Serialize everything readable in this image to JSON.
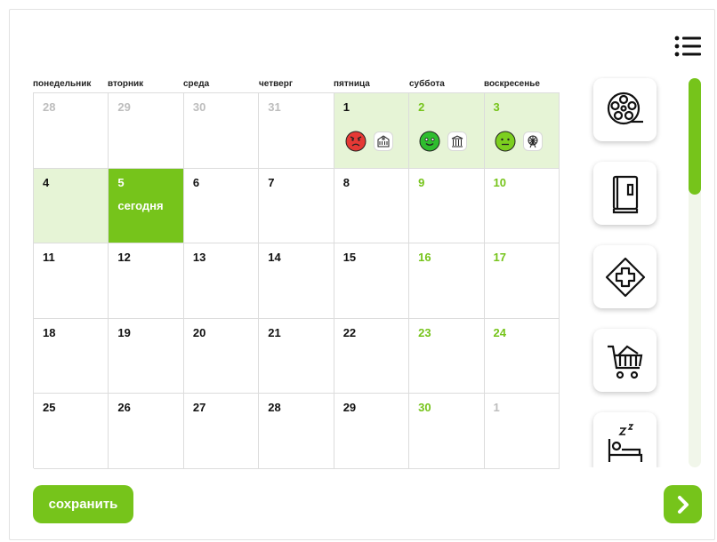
{
  "calendar": {
    "weekdays": [
      "понедельник",
      "вторник",
      "среда",
      "четверг",
      "пятница",
      "суббота",
      "воскресенье"
    ],
    "today_label": "сегодня",
    "weeks": [
      [
        {
          "day": "28",
          "muted": true
        },
        {
          "day": "29",
          "muted": true
        },
        {
          "day": "30",
          "muted": true
        },
        {
          "day": "31",
          "muted": true
        },
        {
          "day": "1",
          "event": {
            "mood": "angry",
            "place": "building"
          }
        },
        {
          "day": "2",
          "weekend": true,
          "event": {
            "mood": "happy",
            "place": "building-columns"
          }
        },
        {
          "day": "3",
          "weekend": true,
          "event": {
            "mood": "neutral",
            "place": "ferris-wheel"
          }
        }
      ],
      [
        {
          "day": "4",
          "highlight": true
        },
        {
          "day": "5",
          "today": true
        },
        {
          "day": "6"
        },
        {
          "day": "7"
        },
        {
          "day": "8"
        },
        {
          "day": "9",
          "weekend": true
        },
        {
          "day": "10",
          "weekend": true
        }
      ],
      [
        {
          "day": "11"
        },
        {
          "day": "12"
        },
        {
          "day": "13"
        },
        {
          "day": "14"
        },
        {
          "day": "15"
        },
        {
          "day": "16",
          "weekend": true
        },
        {
          "day": "17",
          "weekend": true
        }
      ],
      [
        {
          "day": "18"
        },
        {
          "day": "19"
        },
        {
          "day": "20"
        },
        {
          "day": "21"
        },
        {
          "day": "22"
        },
        {
          "day": "23",
          "weekend": true
        },
        {
          "day": "24",
          "weekend": true
        }
      ],
      [
        {
          "day": "25"
        },
        {
          "day": "26"
        },
        {
          "day": "27"
        },
        {
          "day": "28"
        },
        {
          "day": "29"
        },
        {
          "day": "30",
          "weekend": true
        },
        {
          "day": "1",
          "muted": true
        }
      ]
    ]
  },
  "activities": [
    "film-reel-icon",
    "book-icon",
    "medical-cross-icon",
    "shopping-cart-icon",
    "sleep-icon"
  ],
  "actions": {
    "save_label": "сохранить",
    "next_icon": "chevron-right-icon",
    "menu_icon": "list-menu-icon"
  },
  "colors": {
    "accent": "#76c41b",
    "event_bg": "#e6f4d6",
    "angry": "#e53935",
    "happy": "#2ebd2e",
    "neutral": "#7ccf1f"
  }
}
